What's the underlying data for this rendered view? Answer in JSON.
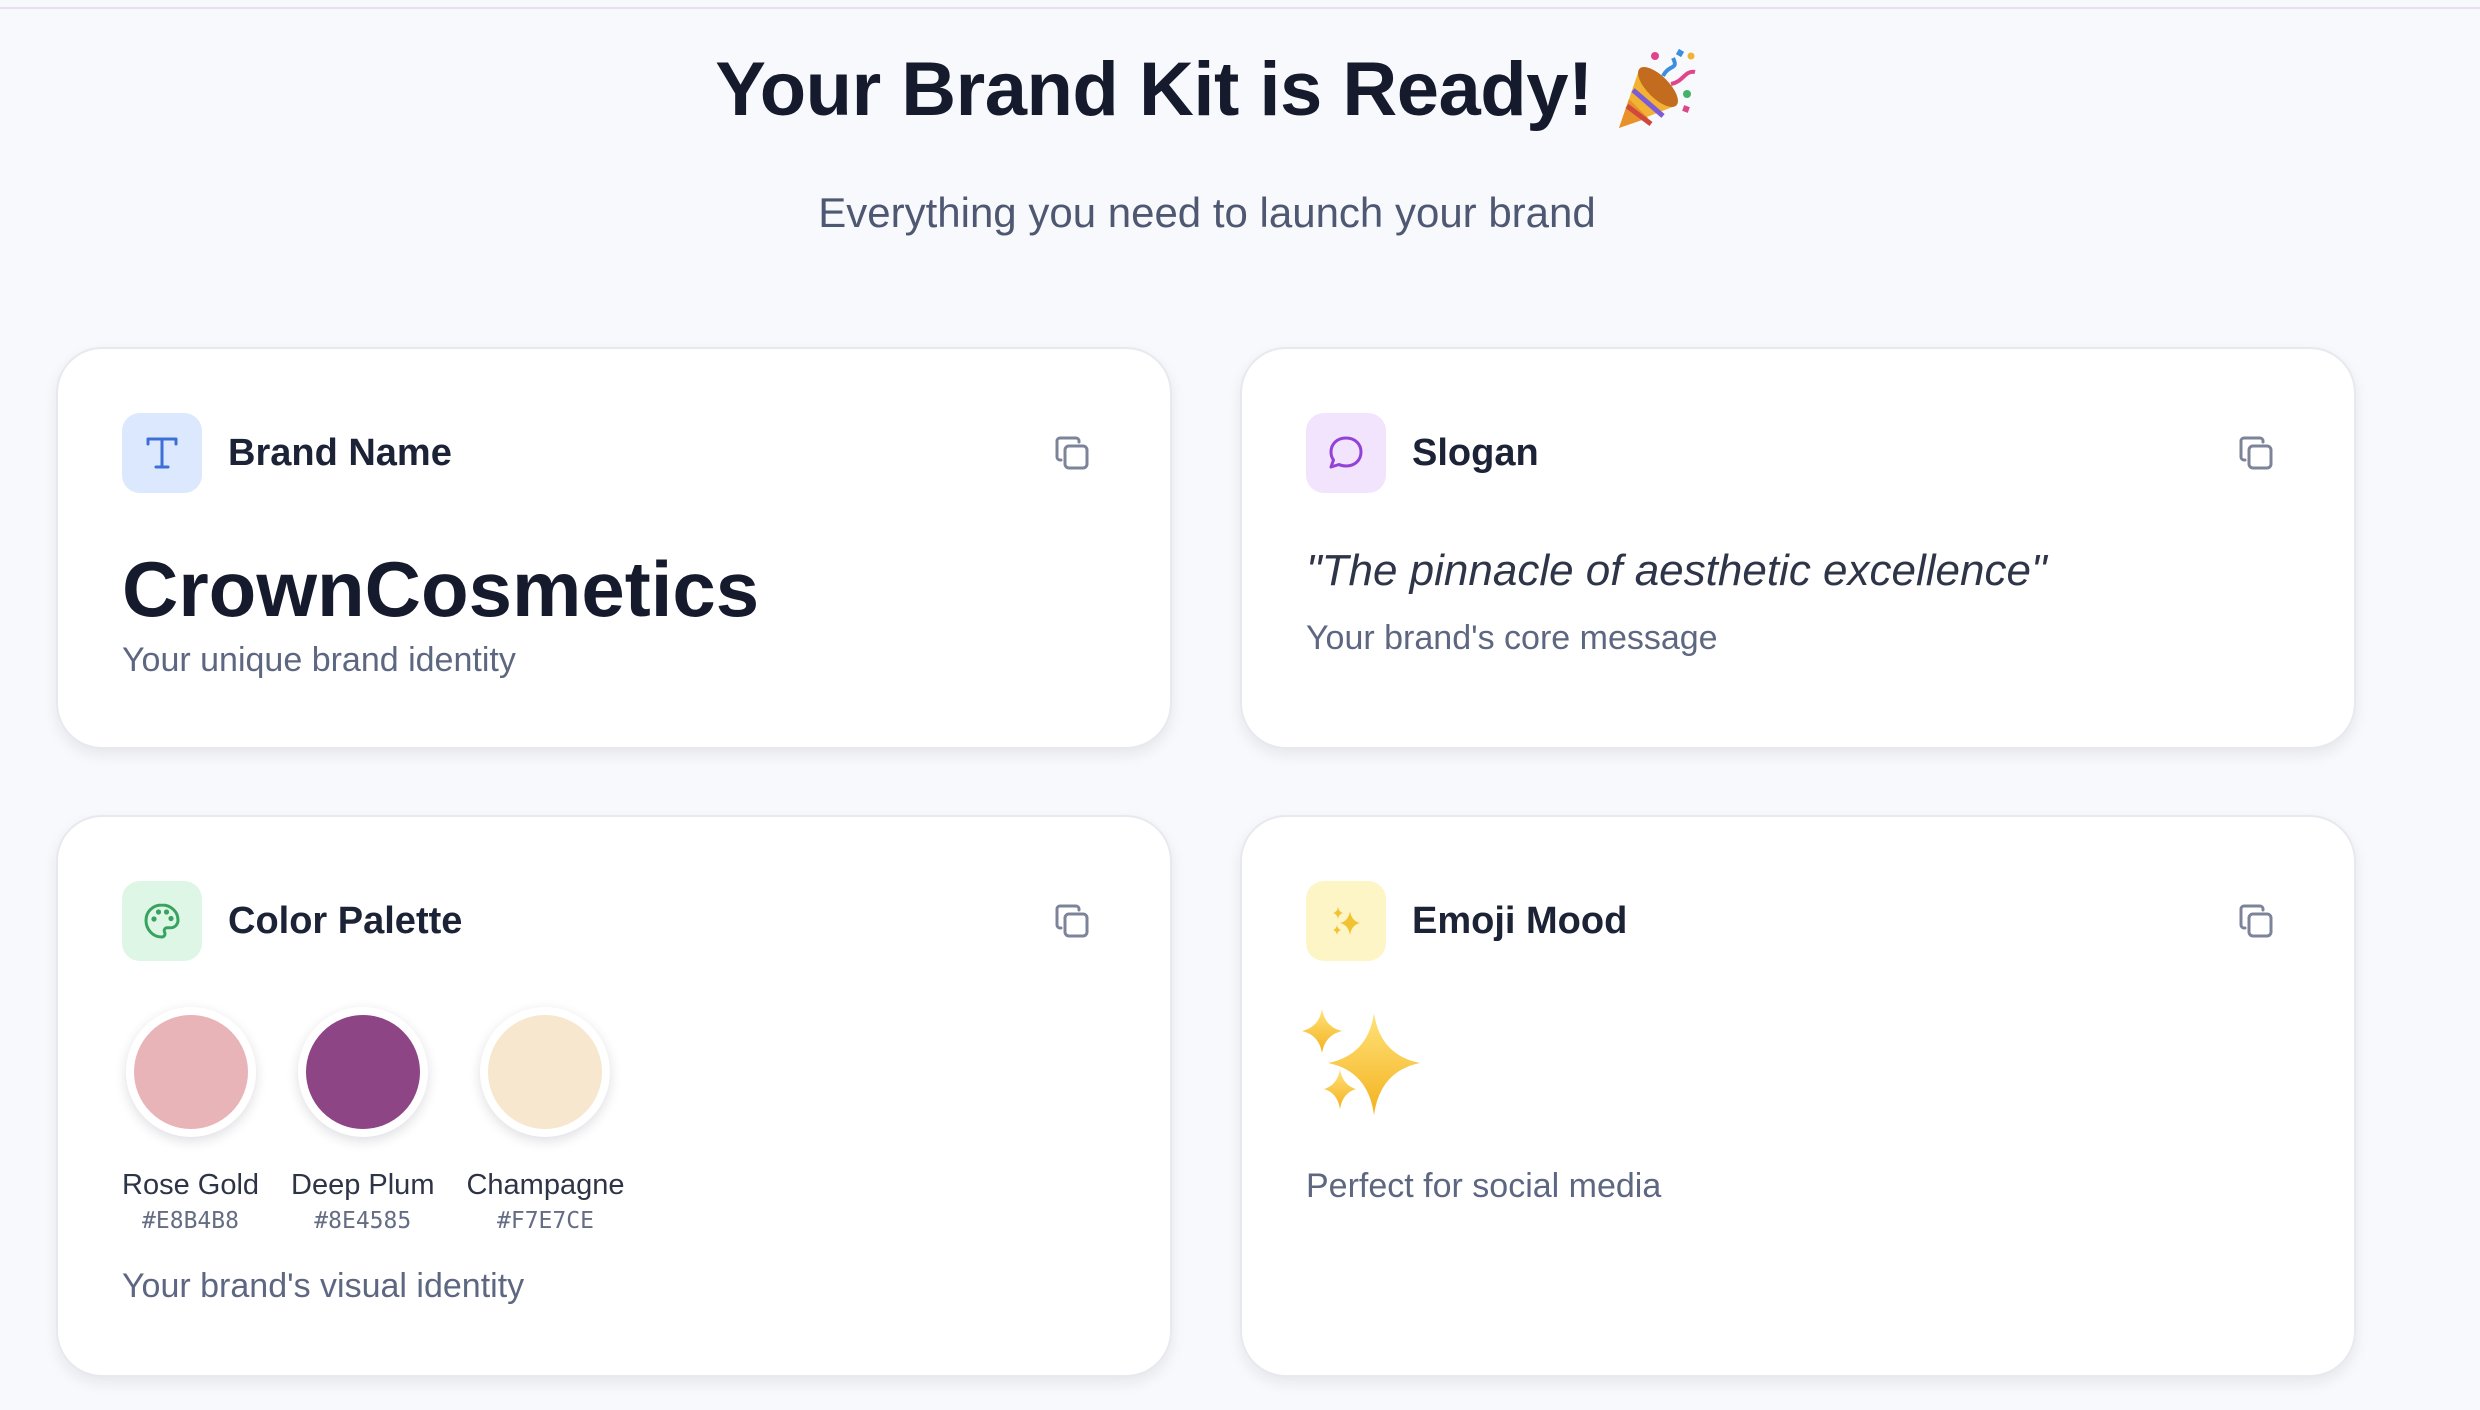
{
  "header": {
    "title": "Your Brand Kit is Ready!",
    "title_icon": "party-popper-icon",
    "subtitle": "Everything you need to launch your brand"
  },
  "cards": {
    "brand_name": {
      "label": "Brand Name",
      "icon": "text-icon",
      "value": "CrownCosmetics",
      "description": "Your unique brand identity"
    },
    "slogan": {
      "label": "Slogan",
      "icon": "message-bubble-icon",
      "value": "\"The pinnacle of aesthetic excellence\"",
      "description": "Your brand's core message"
    },
    "color_palette": {
      "label": "Color Palette",
      "icon": "palette-icon",
      "colors": [
        {
          "name": "Rose Gold",
          "hex": "#E8B4B8"
        },
        {
          "name": "Deep Plum",
          "hex": "#8E4585"
        },
        {
          "name": "Champagne",
          "hex": "#F7E7CE"
        }
      ],
      "description": "Your brand's visual identity"
    },
    "emoji_mood": {
      "label": "Emoji Mood",
      "icon": "sparkles-icon",
      "value": "✨",
      "description": "Perfect for social media"
    }
  },
  "colors": {
    "background": "#f8f9fc",
    "card": "#ffffff",
    "text_primary": "#151a2d",
    "text_muted": "#5e6781",
    "tile_blue": "#dbe8fd",
    "tile_purple": "#f1e4fc",
    "tile_green": "#ddf6e6",
    "tile_yellow": "#fdf5c5"
  }
}
